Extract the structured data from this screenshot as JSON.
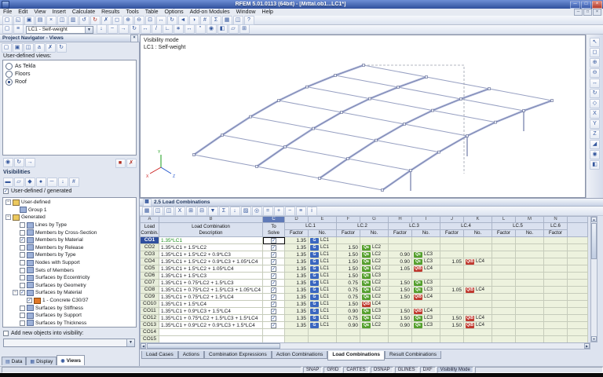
{
  "titlebar": {
    "title": "RFEM 5.01.0113 (64bit) - [Mittal.ob1...LC1*]"
  },
  "menubar": {
    "items": [
      "File",
      "Edit",
      "View",
      "Insert",
      "Calculate",
      "Results",
      "Tools",
      "Table",
      "Options",
      "Add-on Modules",
      "Window",
      "Help"
    ]
  },
  "toolbars": {
    "main": [
      "new",
      "open",
      "save",
      "print",
      "cut",
      "copy",
      "paste",
      "undo",
      "redo",
      "delete",
      "zoom-window",
      "zoom-in",
      "zoom-out",
      "zoom-all",
      "pan",
      "rotate",
      "previous-view",
      "render",
      "numbering",
      "calculate",
      "tables",
      "panels",
      "help"
    ],
    "edit_left": [
      "new-load-case",
      "edit-load-cases"
    ],
    "lc_selector": "LC1 - Self-weight",
    "edit_right": [
      "show-loads",
      "show-results",
      "move-copy",
      "rotate-members",
      "mirror",
      "divide",
      "connect",
      "generate",
      "dimensions",
      "comments",
      "visibility-mode",
      "clipping",
      "work-plane",
      "snap-settings"
    ],
    "right_strip": [
      "pointer",
      "zoom-window",
      "zoom-in",
      "zoom-out",
      "pan",
      "rotate-view",
      "view-isometric",
      "view-x",
      "view-y",
      "view-z",
      "perspective",
      "visibility",
      "clip-plane"
    ],
    "table": [
      "table-settings",
      "view-mode",
      "copy-row",
      "excel-export",
      "insert-row",
      "delete-row",
      "filter",
      "sum",
      "fill-down",
      "color-scale",
      "find",
      "calculator",
      "expand",
      "collapse",
      "settings",
      "info"
    ],
    "navigator": [
      "new-view",
      "save-view",
      "copy-view",
      "rename-view",
      "delete-view",
      "refresh"
    ],
    "nav_small_left": [
      "set-view",
      "update-view",
      "arrow-view"
    ],
    "nav_small_right": [
      "delete-red",
      "close-red"
    ]
  },
  "navigator": {
    "title": "Project Navigator - Views",
    "views_label": "User-defined views:",
    "views": [
      {
        "label": "As Tekla",
        "selected": false
      },
      {
        "label": "Floors",
        "selected": false
      },
      {
        "label": "Roof",
        "selected": true
      }
    ],
    "visibilities_label": "Visibilities",
    "vis_icons": [
      "vis-members",
      "vis-surfaces",
      "vis-solids",
      "vis-nodes",
      "vis-lines",
      "vis-loads",
      "vis-numbering"
    ],
    "user_generated_label": "User-defined / generated",
    "user_generated_checked": true,
    "tree": [
      {
        "label": "User-defined",
        "level": 0,
        "type": "folder",
        "expanded": true
      },
      {
        "label": "Group 1",
        "level": 1,
        "type": "group"
      },
      {
        "label": "Generated",
        "level": 0,
        "type": "folder",
        "expanded": true
      },
      {
        "label": "Lines by Type",
        "level": 1,
        "type": "item",
        "checked": false
      },
      {
        "label": "Members by Cross-Section",
        "level": 1,
        "type": "item",
        "checked": false
      },
      {
        "label": "Members by Material",
        "level": 1,
        "type": "item",
        "checked": true
      },
      {
        "label": "Members by Release",
        "level": 1,
        "type": "item",
        "checked": false
      },
      {
        "label": "Members by Type",
        "level": 1,
        "type": "item",
        "checked": false
      },
      {
        "label": "Nodes with Support",
        "level": 1,
        "type": "item",
        "checked": false
      },
      {
        "label": "Sets of Members",
        "level": 1,
        "type": "item",
        "checked": false
      },
      {
        "label": "Surfaces by Eccentricity",
        "level": 1,
        "type": "item",
        "checked": false
      },
      {
        "label": "Surfaces by Geometry",
        "level": 1,
        "type": "item",
        "checked": false
      },
      {
        "label": "Surfaces by Material",
        "level": 1,
        "type": "item",
        "checked": true,
        "expanded": true
      },
      {
        "label": "1 - Concrete C30/37",
        "level": 2,
        "type": "material",
        "checked": true
      },
      {
        "label": "Surfaces by Stiffness",
        "level": 1,
        "type": "item",
        "checked": false
      },
      {
        "label": "Surfaces by Support",
        "level": 1,
        "type": "item",
        "checked": false
      },
      {
        "label": "Surfaces by Thickness",
        "level": 1,
        "type": "item",
        "checked": false
      }
    ],
    "add_new_label": "Add new objects into visibility:",
    "add_new_checked": false,
    "tabs": [
      {
        "label": "Data",
        "active": false
      },
      {
        "label": "Display",
        "active": false
      },
      {
        "label": "Views",
        "active": true
      }
    ]
  },
  "viewport": {
    "mode_label": "Visibility mode",
    "case_label": "LC1 : Self-weight",
    "axes": {
      "x": "X",
      "y": "Y",
      "z": "Z"
    }
  },
  "table_panel": {
    "title": "2.5 Load Combinations",
    "col_letters": [
      "A",
      "B",
      "C",
      "D",
      "E",
      "F",
      "G",
      "H",
      "I",
      "J",
      "K",
      "L",
      "M",
      "N"
    ],
    "selected_col": "C",
    "headers": {
      "combo_line1": "Load",
      "combo_line2": "Combin.",
      "desc_line1": "Load Combination",
      "desc_line2": "Description",
      "solve_line1": "To",
      "solve_line2": "Solve",
      "factor": "Factor",
      "no": "No.",
      "groups": [
        "LC.1",
        "LC.2",
        "LC.3",
        "LC.4",
        "LC.5",
        "LC.6"
      ]
    },
    "rows": [
      {
        "id": "CO1",
        "desc": "1.35*LC1",
        "solve": true,
        "selected": true,
        "slots": [
          {
            "f": "1.35",
            "cat": "G",
            "lc": "LC1"
          }
        ]
      },
      {
        "id": "CO2",
        "desc": "1.35*LC1 + 1.5*LC2",
        "solve": true,
        "slots": [
          {
            "f": "1.35",
            "cat": "G",
            "lc": "LC1"
          },
          {
            "f": "1.50",
            "cat": "Qa",
            "lc": "LC2"
          }
        ]
      },
      {
        "id": "CO3",
        "desc": "1.35*LC1 + 1.5*LC2 + 0.9*LC3",
        "solve": true,
        "slots": [
          {
            "f": "1.35",
            "cat": "G",
            "lc": "LC1"
          },
          {
            "f": "1.50",
            "cat": "Qa",
            "lc": "LC2"
          },
          {
            "f": "0.90",
            "cat": "Qs",
            "lc": "LC3"
          }
        ]
      },
      {
        "id": "CO4",
        "desc": "1.35*LC1 + 1.5*LC2 + 0.9*LC3 + 1.05*LC4",
        "solve": true,
        "slots": [
          {
            "f": "1.35",
            "cat": "G",
            "lc": "LC1"
          },
          {
            "f": "1.50",
            "cat": "Qa",
            "lc": "LC2"
          },
          {
            "f": "0.90",
            "cat": "Qs",
            "lc": "LC3"
          },
          {
            "f": "1.05",
            "cat": "QiB",
            "lc": "LC4"
          }
        ]
      },
      {
        "id": "CO5",
        "desc": "1.35*LC1 + 1.5*LC2 + 1.05*LC4",
        "solve": true,
        "slots": [
          {
            "f": "1.35",
            "cat": "G",
            "lc": "LC1"
          },
          {
            "f": "1.50",
            "cat": "Qa",
            "lc": "LC2"
          },
          {
            "f": "1.05",
            "cat": "QiB",
            "lc": "LC4"
          }
        ]
      },
      {
        "id": "CO6",
        "desc": "1.35*LC1 + 1.5*LC3",
        "solve": true,
        "slots": [
          {
            "f": "1.35",
            "cat": "G",
            "lc": "LC1"
          },
          {
            "f": "1.50",
            "cat": "Qs",
            "lc": "LC3"
          }
        ]
      },
      {
        "id": "CO7",
        "desc": "1.35*LC1 + 0.75*LC2 + 1.5*LC3",
        "solve": true,
        "slots": [
          {
            "f": "1.35",
            "cat": "G",
            "lc": "LC1"
          },
          {
            "f": "0.75",
            "cat": "Qa",
            "lc": "LC2"
          },
          {
            "f": "1.50",
            "cat": "Qs",
            "lc": "LC3"
          }
        ]
      },
      {
        "id": "CO8",
        "desc": "1.35*LC1 + 0.75*LC2 + 1.5*LC3 + 1.05*LC4",
        "solve": true,
        "slots": [
          {
            "f": "1.35",
            "cat": "G",
            "lc": "LC1"
          },
          {
            "f": "0.75",
            "cat": "Qa",
            "lc": "LC2"
          },
          {
            "f": "1.50",
            "cat": "Qs",
            "lc": "LC3"
          },
          {
            "f": "1.05",
            "cat": "QiB",
            "lc": "LC4"
          }
        ]
      },
      {
        "id": "CO9",
        "desc": "1.35*LC1 + 0.75*LC2 + 1.5*LC4",
        "solve": true,
        "slots": [
          {
            "f": "1.35",
            "cat": "G",
            "lc": "LC1"
          },
          {
            "f": "0.75",
            "cat": "Qa",
            "lc": "LC2"
          },
          {
            "f": "1.50",
            "cat": "QiB",
            "lc": "LC4"
          }
        ]
      },
      {
        "id": "CO10",
        "desc": "1.35*LC1 + 1.5*LC4",
        "solve": true,
        "slots": [
          {
            "f": "1.35",
            "cat": "G",
            "lc": "LC1"
          },
          {
            "f": "1.50",
            "cat": "QiB",
            "lc": "LC4"
          }
        ]
      },
      {
        "id": "CO11",
        "desc": "1.35*LC1 + 0.9*LC3 + 1.5*LC4",
        "solve": true,
        "slots": [
          {
            "f": "1.35",
            "cat": "G",
            "lc": "LC1"
          },
          {
            "f": "0.90",
            "cat": "Qs",
            "lc": "LC3"
          },
          {
            "f": "1.50",
            "cat": "QiB",
            "lc": "LC4"
          }
        ]
      },
      {
        "id": "CO12",
        "desc": "1.35*LC1 + 0.75*LC2 + 1.5*LC3 + 1.5*LC4",
        "solve": true,
        "slots": [
          {
            "f": "1.35",
            "cat": "G",
            "lc": "LC1"
          },
          {
            "f": "0.75",
            "cat": "Qa",
            "lc": "LC2"
          },
          {
            "f": "1.50",
            "cat": "Qs",
            "lc": "LC3"
          },
          {
            "f": "1.50",
            "cat": "QiB",
            "lc": "LC4"
          }
        ]
      },
      {
        "id": "CO13",
        "desc": "1.35*LC1 + 0.9*LC2 + 0.9*LC3 + 1.5*LC4",
        "solve": true,
        "slots": [
          {
            "f": "1.35",
            "cat": "G",
            "lc": "LC1"
          },
          {
            "f": "0.90",
            "cat": "Qa",
            "lc": "LC2"
          },
          {
            "f": "0.90",
            "cat": "Qs",
            "lc": "LC3"
          },
          {
            "f": "1.50",
            "cat": "QiB",
            "lc": "LC4"
          }
        ]
      },
      {
        "id": "CO14",
        "desc": "",
        "solve": null,
        "slots": []
      },
      {
        "id": "CO15",
        "desc": "",
        "solve": null,
        "slots": []
      }
    ],
    "tabs": [
      {
        "label": "Load Cases",
        "active": false
      },
      {
        "label": "Actions",
        "active": false
      },
      {
        "label": "Combination Expressions",
        "active": false
      },
      {
        "label": "Action Combinations",
        "active": false
      },
      {
        "label": "Load Combinations",
        "active": true
      },
      {
        "label": "Result Combinations",
        "active": false
      }
    ]
  },
  "statusbar": {
    "toggles": [
      "SNAP",
      "GRID",
      "CARTES",
      "OSNAP",
      "GLINES",
      "DXF"
    ],
    "mode": "Visibility Mode"
  },
  "colors": {
    "title_accent": "#30509c",
    "selection": "#2f4f9e",
    "cell_green": "#edf2de",
    "cat_G": "#3a67c0",
    "cat_Qa": "#55a02e",
    "cat_Qs": "#55a02e",
    "cat_QiB": "#c03a30",
    "member": "#9aa4cf",
    "desc_highlight": "#1d8f1d",
    "axis_x": "#cc2222",
    "axis_y": "#1a9e1a",
    "axis_z": "#2255cc"
  }
}
